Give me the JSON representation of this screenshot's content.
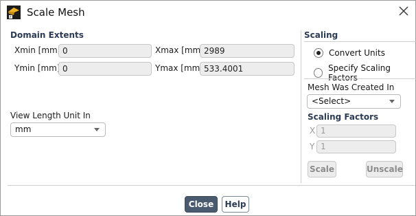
{
  "window": {
    "title": "Scale Mesh",
    "close_glyph": "×"
  },
  "domain_extents": {
    "heading": "Domain Extents",
    "xmin": {
      "label": "Xmin [mm]",
      "value": "0"
    },
    "xmax": {
      "label": "Xmax [mm]",
      "value": "2989"
    },
    "ymin": {
      "label": "Ymin [mm]",
      "value": "0"
    },
    "ymax": {
      "label": "Ymax [mm]",
      "value": "533.4001"
    }
  },
  "view_length": {
    "label": "View Length Unit In",
    "selected": "mm"
  },
  "scaling": {
    "heading": "Scaling",
    "options": [
      {
        "label": "Convert Units",
        "selected": true
      },
      {
        "label": "Specify Scaling Factors",
        "selected": false
      }
    ],
    "mesh_created_label": "Mesh Was Created In",
    "mesh_created_selected": "<Select>",
    "factors_heading": "Scaling Factors",
    "factor_x": {
      "axis": "X",
      "value": "1"
    },
    "factor_y": {
      "axis": "Y",
      "value": "1"
    },
    "scale_label": "Scale",
    "unscale_label": "Unscale"
  },
  "footer": {
    "close_label": "Close",
    "help_label": "Help"
  },
  "colors": {
    "primary_button": "#4a5a6f",
    "heading": "#2b3a55",
    "field_bg": "#ededed"
  },
  "icons": {
    "app": "ansys-fluent-icon",
    "close": "close-icon"
  }
}
